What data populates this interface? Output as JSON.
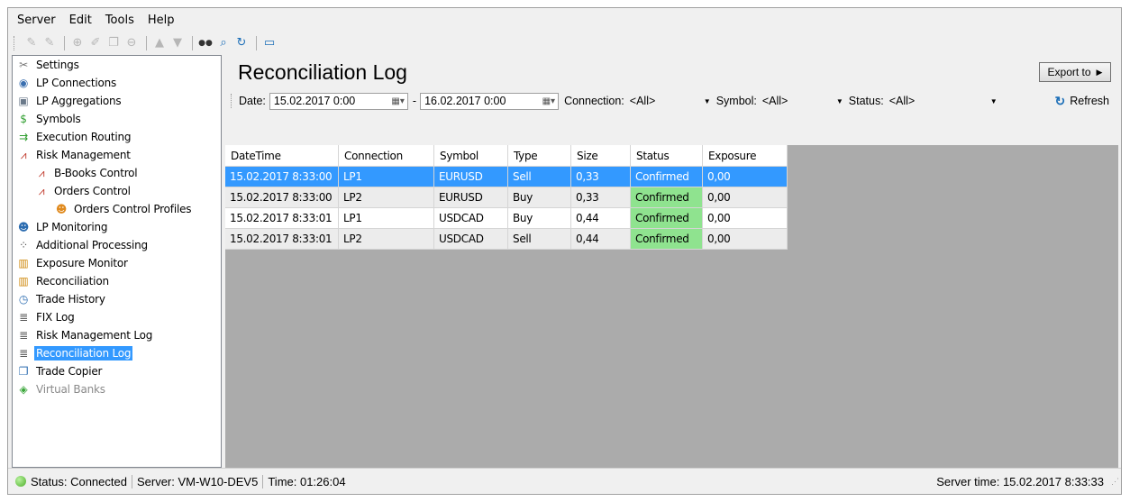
{
  "menu": [
    "Server",
    "Edit",
    "Tools",
    "Help"
  ],
  "toolbar": [
    {
      "icon": "connect-icon",
      "glyph": "✎",
      "state": "dis"
    },
    {
      "icon": "disconnect-icon",
      "glyph": "✎",
      "state": "dis"
    },
    {
      "icon": "add-icon",
      "glyph": "⊕",
      "state": "dis"
    },
    {
      "icon": "edit-icon",
      "glyph": "✐",
      "state": "dis"
    },
    {
      "icon": "copy-icon",
      "glyph": "❐",
      "state": "dis"
    },
    {
      "icon": "remove-icon",
      "glyph": "⊖",
      "state": "dis"
    },
    {
      "icon": "move-up-icon",
      "glyph": "▲",
      "state": "dis"
    },
    {
      "icon": "move-down-icon",
      "glyph": "▼",
      "state": "dis"
    },
    {
      "icon": "binoculars-icon",
      "glyph": "●●",
      "state": ""
    },
    {
      "icon": "search-icon",
      "glyph": "⌕",
      "state": "on"
    },
    {
      "icon": "refresh-icon",
      "glyph": "↻",
      "state": "on"
    },
    {
      "icon": "window-icon",
      "glyph": "▭",
      "state": "on"
    }
  ],
  "sidebar": {
    "items": [
      {
        "label": "Settings",
        "icon": "settings-icon",
        "glyph": "✂",
        "color": "#777",
        "level": 0
      },
      {
        "label": "LP Connections",
        "icon": "lp-connections-icon",
        "glyph": "◉",
        "color": "#3a6fb0",
        "level": 0
      },
      {
        "label": "LP Aggregations",
        "icon": "lp-aggregations-icon",
        "glyph": "▣",
        "color": "#6b7a8a",
        "level": 0
      },
      {
        "label": "Symbols",
        "icon": "dollar-icon",
        "glyph": "$",
        "color": "#2f9e2f",
        "level": 0
      },
      {
        "label": "Execution Routing",
        "icon": "routing-icon",
        "glyph": "⇉",
        "color": "#2f9e2f",
        "level": 0
      },
      {
        "label": "Risk Management",
        "icon": "chart-icon",
        "glyph": "⩘",
        "color": "#c0392b",
        "level": 0
      },
      {
        "label": "B-Books Control",
        "icon": "chart-icon",
        "glyph": "⩘",
        "color": "#c0392b",
        "level": 1
      },
      {
        "label": "Orders Control",
        "icon": "chart-icon",
        "glyph": "⩘",
        "color": "#c0392b",
        "level": 1
      },
      {
        "label": "Orders Control Profiles",
        "icon": "user-icon",
        "glyph": "☻",
        "color": "#e08a1e",
        "level": 2
      },
      {
        "label": "LP Monitoring",
        "icon": "user-icon",
        "glyph": "☻",
        "color": "#2b6cb0",
        "level": 0
      },
      {
        "label": "Additional Processing",
        "icon": "spinner-icon",
        "glyph": "⁘",
        "color": "#555",
        "level": 0
      },
      {
        "label": "Exposure Monitor",
        "icon": "bar-chart-icon",
        "glyph": "▥",
        "color": "#d08a10",
        "level": 0
      },
      {
        "label": "Reconciliation",
        "icon": "bar-chart-icon",
        "glyph": "▥",
        "color": "#d08a10",
        "level": 0
      },
      {
        "label": "Trade History",
        "icon": "history-icon",
        "glyph": "◷",
        "color": "#2b6cb0",
        "level": 0
      },
      {
        "label": "FIX Log",
        "icon": "log-icon",
        "glyph": "≣",
        "color": "#555",
        "level": 0
      },
      {
        "label": "Risk Management Log",
        "icon": "log-icon",
        "glyph": "≣",
        "color": "#555",
        "level": 0
      },
      {
        "label": "Reconciliation Log",
        "icon": "log-icon",
        "glyph": "≣",
        "color": "#555",
        "level": 0,
        "selected": true
      },
      {
        "label": "Trade Copier",
        "icon": "copy-icon",
        "glyph": "❐",
        "color": "#2b6cb0",
        "level": 0
      },
      {
        "label": "Virtual Banks",
        "icon": "bank-icon",
        "glyph": "◈",
        "color": "#3aa63a",
        "level": 0,
        "disabled": true
      }
    ]
  },
  "main": {
    "title": "Reconciliation Log",
    "export_label": "Export to",
    "filter": {
      "date_label": "Date:",
      "date_from": "15.02.2017  0:00",
      "dash": "-",
      "date_to": "16.02.2017  0:00",
      "connection_label": "Connection:",
      "connection_value": "<All>",
      "symbol_label": "Symbol:",
      "symbol_value": "<All>",
      "status_label": "Status:",
      "status_value": "<All>",
      "refresh_label": "Refresh"
    },
    "table": {
      "columns": [
        "DateTime",
        "Connection",
        "Symbol",
        "Type",
        "Size",
        "Status",
        "Exposure"
      ],
      "rows": [
        [
          "15.02.2017 8:33:00",
          "LP1",
          "EURUSD",
          "Sell",
          "0,33",
          "Confirmed",
          "0,00"
        ],
        [
          "15.02.2017 8:33:00",
          "LP2",
          "EURUSD",
          "Buy",
          "0,33",
          "Confirmed",
          "0,00"
        ],
        [
          "15.02.2017 8:33:01",
          "LP1",
          "USDCAD",
          "Buy",
          "0,44",
          "Confirmed",
          "0,00"
        ],
        [
          "15.02.2017 8:33:01",
          "LP2",
          "USDCAD",
          "Sell",
          "0,44",
          "Confirmed",
          "0,00"
        ]
      ],
      "selected_row": 0,
      "confirmed_color": "#8fe38f"
    }
  },
  "statusbar": {
    "status": "Status: Connected",
    "server": "Server: VM-W10-DEV5",
    "time": "Time: 01:26:04",
    "server_time": "Server time: 15.02.2017 8:33:33"
  }
}
